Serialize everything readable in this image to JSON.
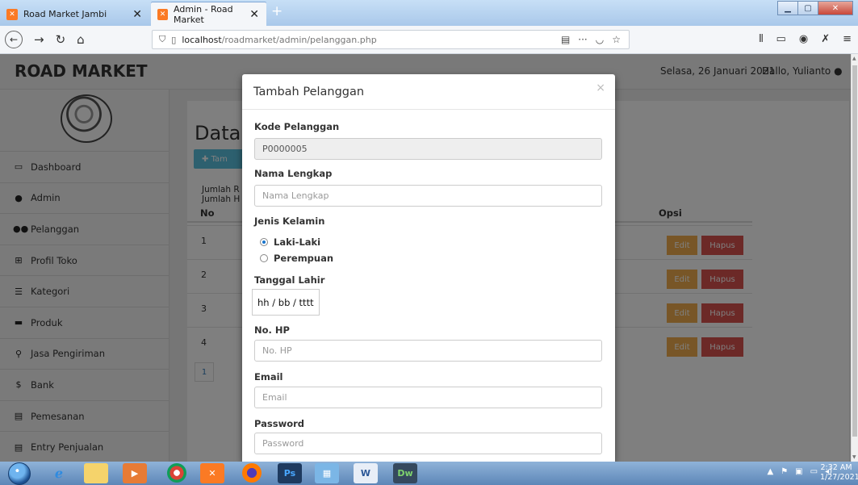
{
  "browser": {
    "tabs": [
      {
        "title": "Road Market Jambi",
        "active": false
      },
      {
        "title": "Admin - Road Market",
        "active": true
      }
    ],
    "url_host": "localhost",
    "url_path": "/roadmarket/admin/pelanggan.php"
  },
  "header": {
    "brand": "ROAD MARKET",
    "date": "Selasa, 26 Januari 2021",
    "greeting": "Hallo, Yulianto"
  },
  "sidebar": {
    "items": [
      {
        "label": "Dashboard",
        "icon": "monitor-icon"
      },
      {
        "label": "Admin",
        "icon": "user-icon"
      },
      {
        "label": "Pelanggan",
        "icon": "users-icon"
      },
      {
        "label": "Profil Toko",
        "icon": "table-icon"
      },
      {
        "label": "Kategori",
        "icon": "list-icon"
      },
      {
        "label": "Produk",
        "icon": "car-icon"
      },
      {
        "label": "Jasa Pengiriman",
        "icon": "map-marker-icon"
      },
      {
        "label": "Bank",
        "icon": "dollar-icon"
      },
      {
        "label": "Pemesanan",
        "icon": "credit-card-icon"
      },
      {
        "label": "Entry Penjualan",
        "icon": "credit-card-icon"
      }
    ]
  },
  "content": {
    "title": "Data",
    "add_button": "Tam",
    "line1": "Jumlah R",
    "line2": "Jumlah H",
    "col_no": "No",
    "col_opsi": "Opsi",
    "rows": [
      {
        "no": "1",
        "edit": "Edit",
        "hapus": "Hapus"
      },
      {
        "no": "2",
        "edit": "Edit",
        "hapus": "Hapus"
      },
      {
        "no": "3",
        "edit": "Edit",
        "hapus": "Hapus"
      },
      {
        "no": "4",
        "edit": "Edit",
        "hapus": "Hapus"
      }
    ],
    "page": "1"
  },
  "modal": {
    "title": "Tambah Pelanggan",
    "close": "×",
    "kode_label": "Kode Pelanggan",
    "kode_value": "P0000005",
    "nama_label": "Nama Lengkap",
    "nama_placeholder": "Nama Lengkap",
    "jk_label": "Jenis Kelamin",
    "jk_options": [
      {
        "label": "Laki-Laki",
        "selected": true
      },
      {
        "label": "Perempuan",
        "selected": false
      }
    ],
    "tgl_label": "Tanggal Lahir",
    "tgl_placeholder": "hh / bb / tttt",
    "hp_label": "No. HP",
    "hp_placeholder": "No. HP",
    "email_label": "Email",
    "email_placeholder": "Email",
    "password_label": "Password",
    "password_placeholder": "Password"
  },
  "taskbar": {
    "time": "2:32 AM",
    "date": "1/27/2021",
    "apps": [
      "Ps",
      "Dw"
    ]
  },
  "colors": {
    "info": "#5bc0de",
    "warning": "#f0ad4e",
    "danger": "#d9534f"
  }
}
